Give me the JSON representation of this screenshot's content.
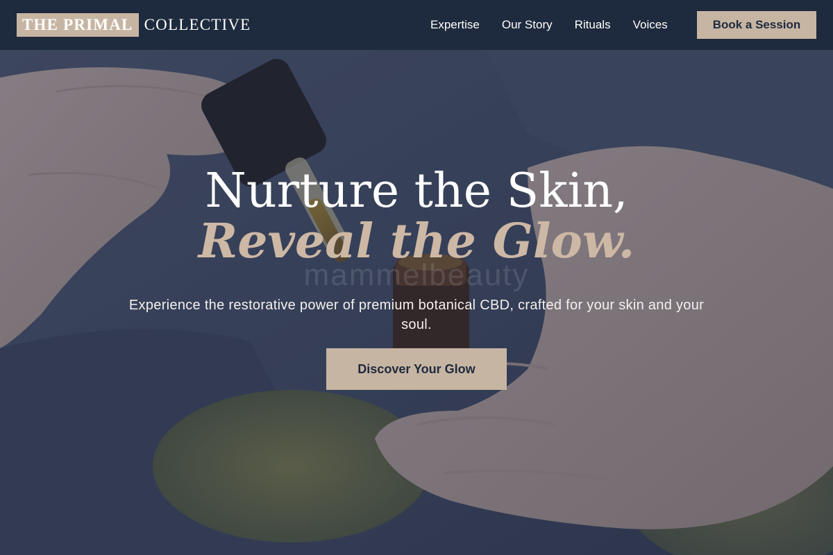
{
  "brand": {
    "boxed": "THE PRIMAL",
    "rest": "COLLECTIVE"
  },
  "nav": {
    "items": [
      {
        "label": "Expertise"
      },
      {
        "label": "Our Story"
      },
      {
        "label": "Rituals"
      },
      {
        "label": "Voices"
      }
    ],
    "cta_label": "Book a Session"
  },
  "hero": {
    "headline": "Nurture the Skin,",
    "headline_accent": "Reveal the Glow.",
    "watermark": "mammelbeauty",
    "subtext": "Experience the restorative power of premium botanical CBD, crafted for your skin and your soul.",
    "cta_label": "Discover Your Glow",
    "background_image": "hands-holding-dropper-bottle-image"
  },
  "colors": {
    "header_bg": "#1e2a3d",
    "accent": "#c7b5a3",
    "headline": "#ffffff",
    "headline_accent": "#cdb8a5"
  }
}
